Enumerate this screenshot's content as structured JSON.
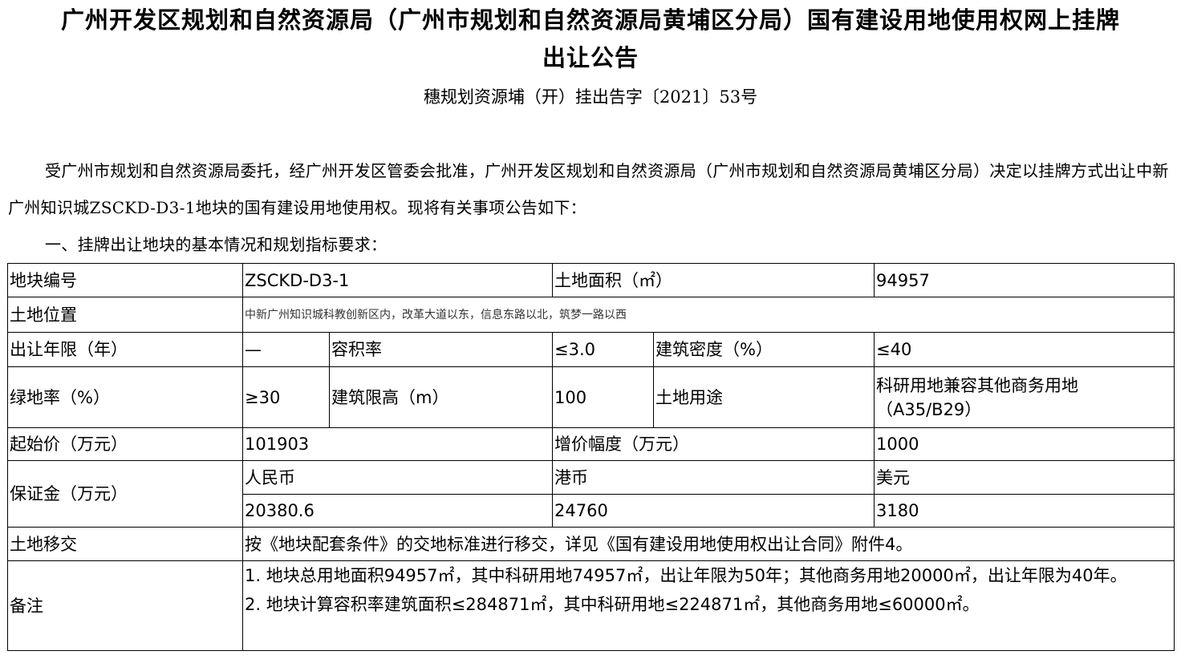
{
  "document": {
    "title_line1": "广州开发区规划和自然资源局（广州市规划和自然资源局黄埔区分局）国有建设用地使用权网上挂牌",
    "title_line2": "出让公告",
    "doc_number": "穗规划资源埔（开）挂出告字〔2021〕53号",
    "intro_paragraph": "受广州市规划和自然资源局委托，经广州开发区管委会批准，广州开发区规划和自然资源局（广州市规划和自然资源局黄埔区分局）决定以挂牌方式出让中新广州知识城ZSCKD-D3-1地块的国有建设用地使用权。现将有关事项公告如下：",
    "section1_heading": "一、挂牌出让地块的基本情况和规划指标要求："
  },
  "parcel_table": {
    "row_parcel": {
      "label_code": "地块编号",
      "code": "ZSCKD-D3-1",
      "label_area": "土地面积（㎡）",
      "area": "94957"
    },
    "row_location": {
      "label": "土地位置",
      "value": "中新广州知识城科教创新区内，改革大道以东，信息东路以北，筑梦一路以西"
    },
    "row_term": {
      "label_term": "出让年限（年）",
      "term": "—",
      "label_far": "容积率",
      "far": "≤3.0",
      "label_density": "建筑密度（%）",
      "density": "≤40"
    },
    "row_green": {
      "label_green": "绿地率（%）",
      "green": "≥30",
      "label_height": "建筑限高（m）",
      "height": "100",
      "label_use": "土地用途",
      "use_line1": "科研用地兼容其他商务用地",
      "use_line2": "（A35/B29）"
    },
    "row_price": {
      "label_start": "起始价（万元）",
      "start": "101903",
      "label_increment": "增价幅度（万元）",
      "increment": "1000"
    },
    "row_deposit": {
      "label": "保证金（万元）",
      "currencies": [
        "人民币",
        "港币",
        "美元"
      ],
      "amounts": [
        "20380.6",
        "24760",
        "3180"
      ]
    },
    "row_handover": {
      "label": "土地移交",
      "value": "按《地块配套条件》的交地标准进行移交，详见《国有建设用地使用权出让合同》附件4。"
    },
    "row_notes": {
      "label": "备注",
      "note1": "1. 地块总用地面积94957㎡，其中科研用地74957㎡，出让年限为50年；其他商务用地20000㎡，出让年限为40年。",
      "note2": "2. 地块计算容积率建筑面积≤284871㎡，其中科研用地≤224871㎡，其他商务用地≤60000㎡。"
    }
  }
}
